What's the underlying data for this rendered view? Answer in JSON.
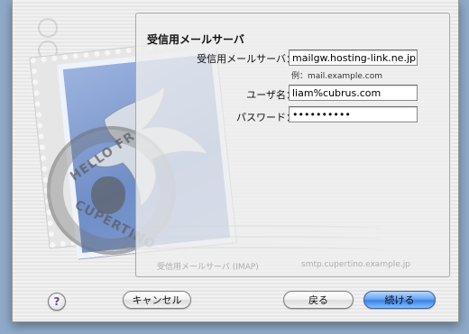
{
  "panel": {
    "title": "受信用メールサーバ"
  },
  "fields": {
    "server": {
      "label": "受信用メールサーバ：",
      "value": "mailgw.hosting-link.ne.jp",
      "hint": "例：mail.example.com"
    },
    "username": {
      "label": "ユーザ名：",
      "value": "liam%cubrus.com"
    },
    "password": {
      "label": "パスワード：",
      "value": "••••••••••"
    }
  },
  "background": {
    "stamp_text_top": "HELLO FR",
    "stamp_text_bottom": "CUPERTINO",
    "ghost_label": "受信用メールサーバ (IMAP)",
    "ghost_value": "smtp.cupertino.example.jp"
  },
  "buttons": {
    "help": "?",
    "cancel": "キャンセル",
    "back": "戻る",
    "continue": "続ける"
  },
  "colors": {
    "desktop": "#8fa9c8",
    "default_button": "#3a83e6",
    "stamp_blue": "#7f9bd0"
  },
  "icons": {
    "help": "question-mark-icon",
    "stamp": "mail-stamp-icon"
  }
}
